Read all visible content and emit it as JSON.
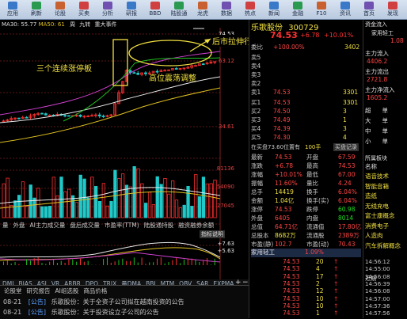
{
  "toolbar": {
    "items": [
      "应用",
      "刷新",
      "论股",
      "买卖",
      "分析",
      "研报",
      "BBD",
      "陆股通",
      "龙虎",
      "数据",
      "热点",
      "新闻",
      "金融",
      "F10",
      "资讯",
      "首页",
      "发现"
    ]
  },
  "chart": {
    "header": {
      "left": "MA30: 55.77",
      "ma50": "MA50: 61",
      "tags": [
        "周",
        "九转",
        "重大事件"
      ]
    },
    "price_labels": [
      "74.53",
      "63.12",
      "34.61"
    ],
    "annotation_limit_up": "三个连续涨停板",
    "annotation_consolidation": "高位震荡调整",
    "annotation_after_hours": "后市拉伸行情",
    "vol_labels": [
      "81136",
      "54090",
      "27045"
    ],
    "vol_tabs": [
      "量",
      "外盘",
      "AI主力成交量",
      "盘后成交量",
      "市盈率(TTM)",
      "陆股通持股",
      "融资融券余额"
    ],
    "indicator_btn": "指标说明",
    "macd_labels": [
      "+7.63",
      "+5.63"
    ],
    "indicator_tabs": [
      "DMI",
      "BIAS",
      "ASI",
      "VR",
      "ARBR",
      "DPO",
      "TRIX",
      "量DMA",
      "BBI",
      "MTM",
      "OBV",
      "SAR",
      "EXPMA"
    ],
    "zoom_icons": [
      "+",
      "−"
    ]
  },
  "news": {
    "tabs": [
      "论股堂",
      "研究报告",
      "AI组选股",
      "商品价格"
    ],
    "items": [
      {
        "date": "08-21",
        "tag": "[公告]",
        "text": "乐歌股份：关于全资子公司拟在越南投资的公告"
      },
      {
        "date": "08-21",
        "tag": "[公告]",
        "text": "乐歌股份：关于投资设立子公司的公告"
      }
    ]
  },
  "quote": {
    "name": "乐歌股份",
    "code": "300729",
    "price": "74.53",
    "change": "+6.78",
    "change_pct": "+10.01%",
    "limit_ratio": "+100.00%",
    "limit_vol": "3402",
    "asks": [
      {
        "label": "卖5",
        "price": "",
        "vol": ""
      },
      {
        "label": "卖4",
        "price": "",
        "vol": ""
      },
      {
        "label": "卖3",
        "price": "",
        "vol": ""
      },
      {
        "label": "卖2",
        "price": "",
        "vol": ""
      },
      {
        "label": "卖1",
        "price": "74.53",
        "vol": "3301"
      }
    ],
    "bids": [
      {
        "label": "买1",
        "price": "74.53",
        "vol": "3301"
      },
      {
        "label": "买2",
        "price": "74.50",
        "vol": "3"
      },
      {
        "label": "买3",
        "price": "74.49",
        "vol": "1"
      },
      {
        "label": "买4",
        "price": "74.39",
        "vol": "3"
      },
      {
        "label": "买5",
        "price": "74.30",
        "vol": "4"
      }
    ],
    "bid_line": {
      "text": "在买盘73.60位置有",
      "vol": "100手",
      "label": "买盘记录"
    },
    "stats": [
      {
        "l1": "最新",
        "v1": "74.53",
        "l2": "开盘",
        "v2": "67.59"
      },
      {
        "l1": "涨跌",
        "v1": "+6.78",
        "l2": "最高",
        "v2": "74.53"
      },
      {
        "l1": "涨幅",
        "v1": "+10.01%",
        "l2": "最低",
        "v2": "67.00"
      },
      {
        "l1": "振幅",
        "v1": "11.60%",
        "l2": "量比",
        "v2": "4.24"
      },
      {
        "l1": "总手",
        "v1": "14419",
        "l2": "换手",
        "v2": "6.04%"
      },
      {
        "l1": "金额",
        "v1": "1.04亿",
        "l2": "换手(实)",
        "v2": "6.04%"
      },
      {
        "l1": "涨停",
        "v1": "74.53",
        "l2": "跌停",
        "v2": "60.98"
      },
      {
        "l1": "外盘",
        "v1": "6405",
        "l2": "内盘",
        "v2": "8014"
      },
      {
        "l1": "总值",
        "v1": "64.71亿",
        "l2": "流通值",
        "v2": "17.80亿"
      },
      {
        "l1": "总股本",
        "v1": "8682万",
        "l2": "流通股",
        "v2": "2389万"
      },
      {
        "l1": "市盈(静)",
        "v1": "102.7",
        "l2": "市盈(动)",
        "v2": "70.43"
      }
    ],
    "sector": {
      "label": "家用轻工",
      "pct": "1.09%"
    },
    "ticks": [
      {
        "price": "74.53",
        "vol": "20"
      },
      {
        "price": "74.53",
        "vol": "4"
      },
      {
        "price": "74.53",
        "vol": "17"
      },
      {
        "price": "74.53",
        "vol": "2"
      },
      {
        "price": "74.53",
        "vol": "12"
      },
      {
        "price": "74.53",
        "vol": "10"
      },
      {
        "price": "74.53",
        "vol": "10"
      },
      {
        "price": "74.53",
        "vol": "1"
      }
    ]
  },
  "side": {
    "header": "资金流入",
    "header_right": "家用轻工",
    "header_val": "1.08",
    "flows": [
      {
        "label": "主力流入",
        "val": "4406.2"
      },
      {
        "label": "主力流出",
        "val": "2721.8"
      },
      {
        "label": "主力净流入",
        "val": "1605.2"
      }
    ],
    "levels": [
      {
        "l": "超",
        "r": "单"
      },
      {
        "l": "大",
        "r": "单"
      },
      {
        "l": "中",
        "r": "单"
      },
      {
        "l": "小",
        "r": "单"
      }
    ],
    "concepts_header": "所属板块",
    "concepts_name": "名称",
    "concepts": [
      "语音技术",
      "智能音箱",
      "造纸",
      "无线充电",
      "富士康概念",
      "消费电子",
      "人造肉",
      "汽车拆解概念"
    ],
    "tick_header": "近期",
    "times": [
      "14:56:12",
      "14:55:00",
      "14:56:08",
      "14:56:39",
      "14:56:08",
      "14:57:00",
      "14:57:36",
      "14:57:56"
    ]
  }
}
